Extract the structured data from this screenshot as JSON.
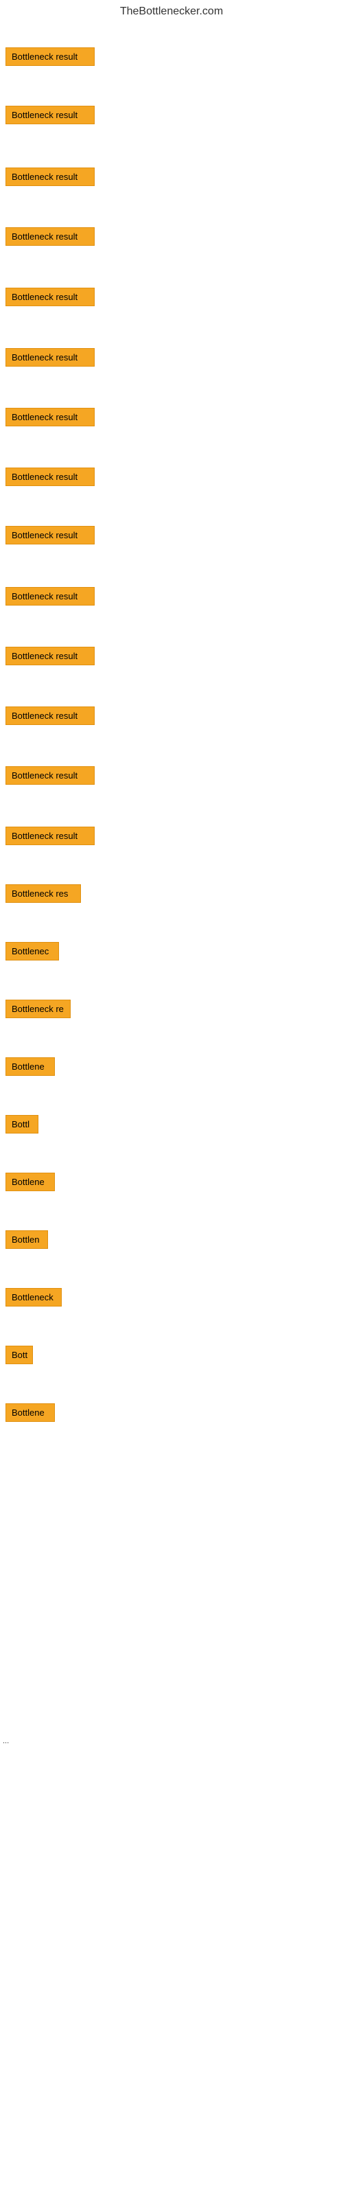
{
  "site": {
    "title": "TheBottlenecker.com"
  },
  "items": [
    {
      "label": "Bottleneck result",
      "width": 130
    },
    {
      "label": "Bottleneck result",
      "width": 130
    },
    {
      "label": "Bottleneck result",
      "width": 130
    },
    {
      "label": "Bottleneck result",
      "width": 130
    },
    {
      "label": "Bottleneck result",
      "width": 130
    },
    {
      "label": "Bottleneck result",
      "width": 130
    },
    {
      "label": "Bottleneck result",
      "width": 130
    },
    {
      "label": "Bottleneck result",
      "width": 130
    },
    {
      "label": "Bottleneck result",
      "width": 130
    },
    {
      "label": "Bottleneck result",
      "width": 130
    },
    {
      "label": "Bottleneck result",
      "width": 130
    },
    {
      "label": "Bottleneck result",
      "width": 130
    },
    {
      "label": "Bottleneck result",
      "width": 130
    },
    {
      "label": "Bottleneck result",
      "width": 130
    },
    {
      "label": "Bottleneck res",
      "width": 110
    },
    {
      "label": "Bottlenec",
      "width": 78
    },
    {
      "label": "Bottleneck re",
      "width": 95
    },
    {
      "label": "Bottlene",
      "width": 72
    },
    {
      "label": "Bottl",
      "width": 48
    },
    {
      "label": "Bottlene",
      "width": 72
    },
    {
      "label": "Bottlen",
      "width": 62
    },
    {
      "label": "Bottleneck",
      "width": 82
    },
    {
      "label": "Bott",
      "width": 40
    },
    {
      "label": "Bottlene",
      "width": 72
    }
  ],
  "ellipsis": "..."
}
